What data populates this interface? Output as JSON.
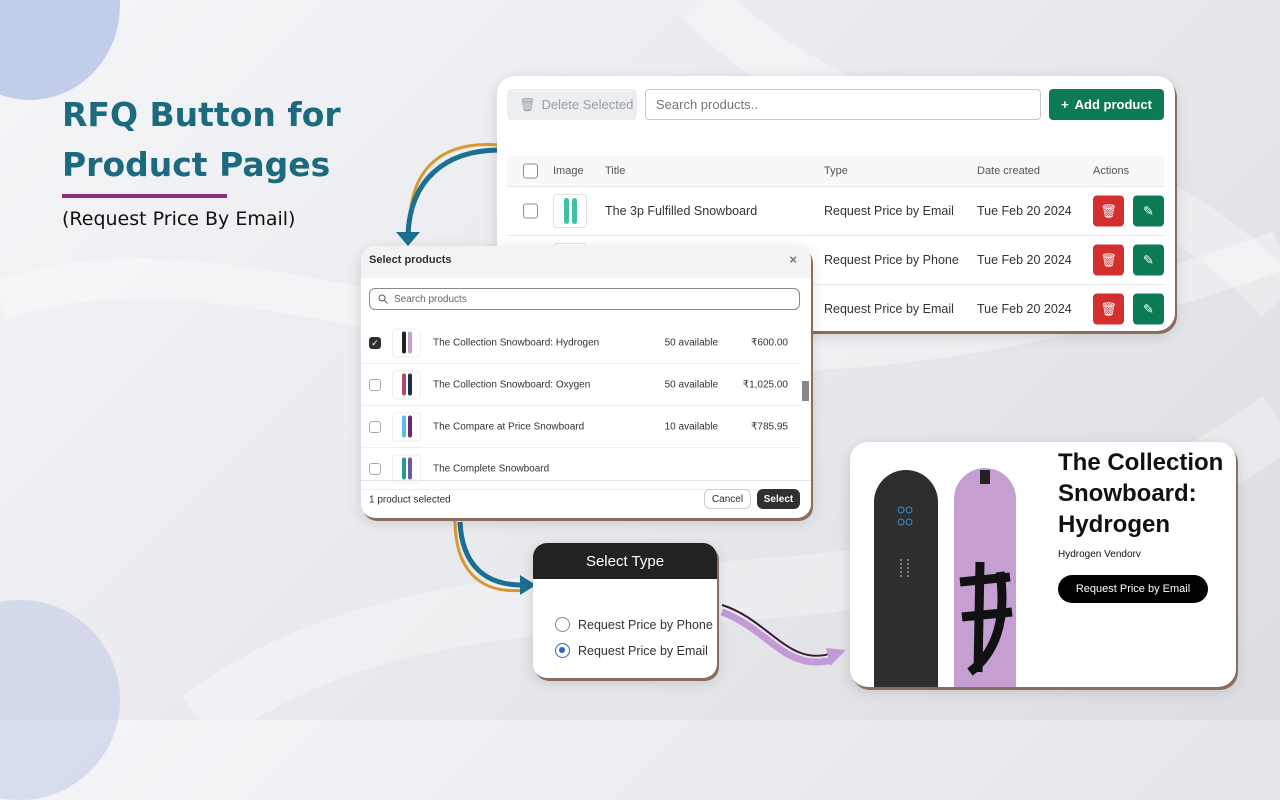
{
  "hero": {
    "title_line1": "RFQ Button for",
    "title_line2": "Product Pages",
    "subtitle": "(Request Price By Email)"
  },
  "colors": {
    "title": "#1b6a7e",
    "underline": "#8a2f7b",
    "primary": "#0c7a55",
    "danger": "#d32f2f"
  },
  "table": {
    "delete_label": "Delete Selected",
    "search_placeholder": "Search products..",
    "add_label": "Add product",
    "columns": [
      "Image",
      "Title",
      "Type",
      "Date created",
      "Actions"
    ],
    "rows": [
      {
        "title": "The 3p Fulfilled Snowboard",
        "type": "Request Price by Email",
        "date": "Tue Feb 20 2024"
      },
      {
        "title": "",
        "type": "Request Price by Phone",
        "date": "Tue Feb 20 2024"
      },
      {
        "title": "",
        "type": "Request Price by Email",
        "date": "Tue Feb 20 2024"
      }
    ]
  },
  "modal": {
    "title": "Select products",
    "close": "×",
    "search_placeholder": "Search products",
    "items": [
      {
        "name": "The Collection Snowboard: Hydrogen",
        "stock": "50 available",
        "price": "₹600.00",
        "checked": true
      },
      {
        "name": "The Collection Snowboard: Oxygen",
        "stock": "50 available",
        "price": "₹1,025.00",
        "checked": false
      },
      {
        "name": "The Compare at Price Snowboard",
        "stock": "10 available",
        "price": "₹785.95",
        "checked": false
      },
      {
        "name": "The Complete Snowboard",
        "stock": "",
        "price": "",
        "checked": false
      }
    ],
    "status": "1 product selected",
    "cancel": "Cancel",
    "select": "Select"
  },
  "select_type": {
    "title": "Select Type",
    "options": [
      {
        "label": "Request Price by Phone",
        "selected": false
      },
      {
        "label": "Request Price by Email",
        "selected": true
      }
    ]
  },
  "preview": {
    "title": "The Collection Snowboard: Hydrogen",
    "vendor": "Hydrogen Vendorv",
    "button": "Request Price by Email"
  }
}
